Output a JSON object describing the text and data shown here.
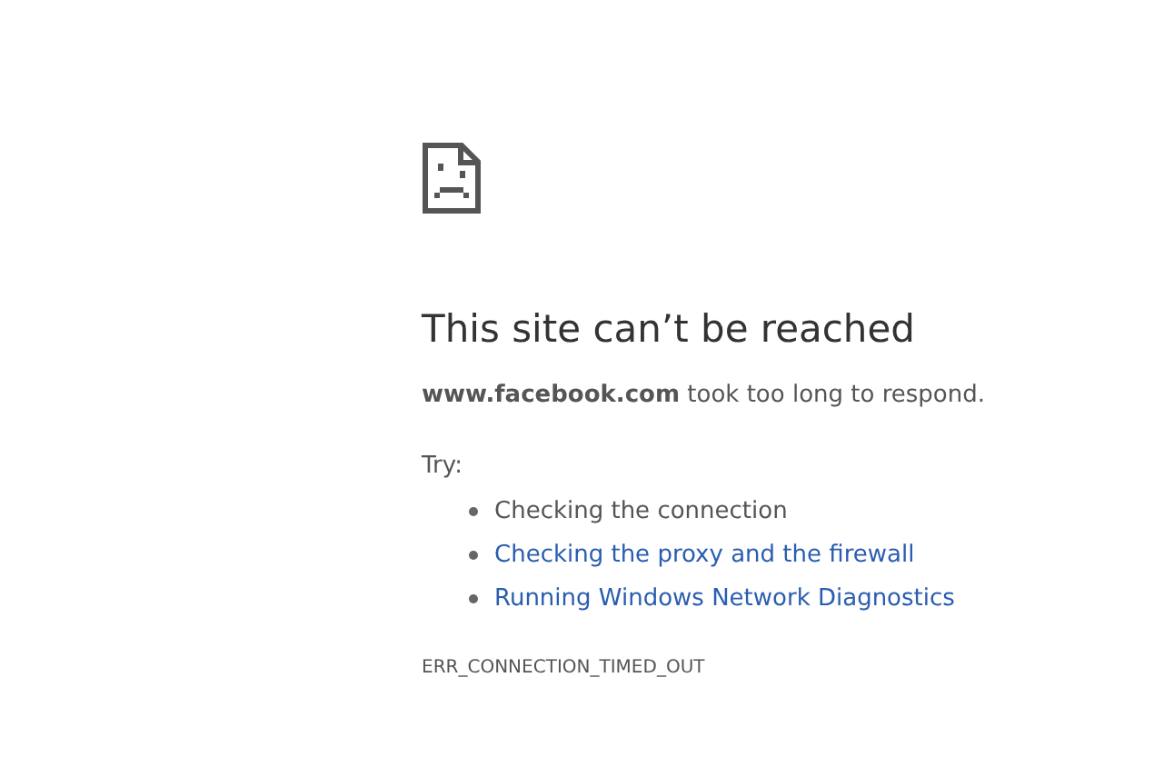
{
  "heading": "This site can’t be reached",
  "description": "**www.facebook.com** took too long to respond.",
  "suggestions_label": "Try:",
  "suggestions": [
    {
      "kind": "text",
      "label": "Checking the connection"
    },
    {
      "kind": "link",
      "label": "Checking the proxy and the firewall"
    },
    {
      "kind": "link",
      "label": "Running Windows Network Diagnostics"
    }
  ],
  "error_code": "ERR_CONNECTION_TIMED_OUT"
}
